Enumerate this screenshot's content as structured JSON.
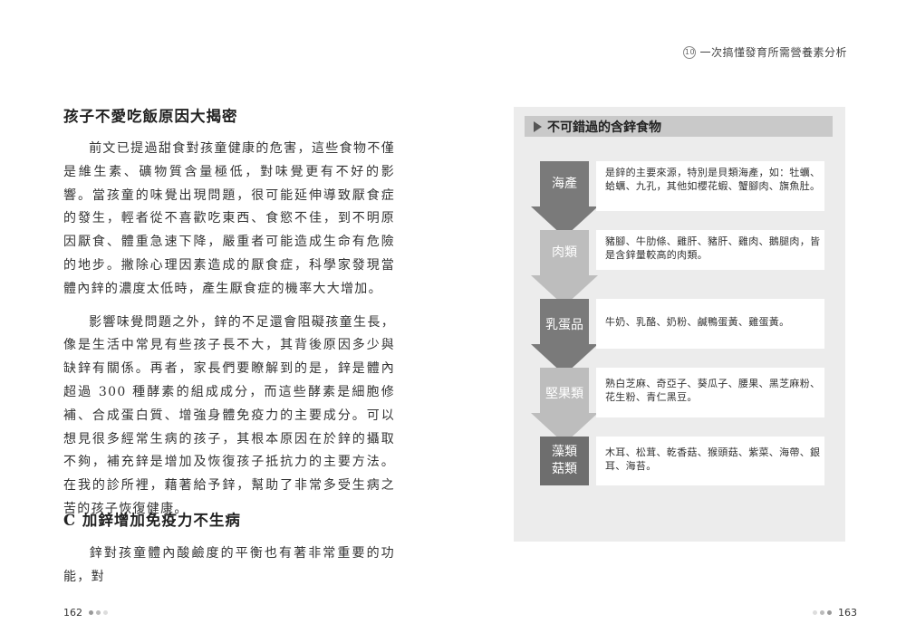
{
  "header": {
    "badge": "10",
    "title": "一次搞懂發育所需營養素分析"
  },
  "left": {
    "heading1": "孩子不愛吃飯原因大揭密",
    "para1": "前文已提過甜食對孩童健康的危害，這些食物不僅是維生素、礦物質含量極低，對味覺更有不好的影響。當孩童的味覺出現問題，很可能延伸導致厭食症的發生，輕者從不喜歡吃東西、食慾不佳，到不明原因厭食、體重急速下降，嚴重者可能造成生命有危險的地步。撇除心理因素造成的厭食症，科學家發現當體內鋅的濃度太低時，產生厭食症的機率大大增加。",
    "para2": "影響味覺問題之外，鋅的不足還會阻礙孩童生長，像是生活中常見有些孩子長不大，其背後原因多少與缺鋅有關係。再者，家長們要瞭解到的是，鋅是體內超過 300 種酵素的組成成分，而這些酵素是細胞修補、合成蛋白質、增強身體免疫力的主要成分。可以想見很多經常生病的孩子，其根本原因在於鋅的攝取不夠，補充鋅是增加及恢復孩子抵抗力的主要方法。在我的診所裡，藉著給予鋅，幫助了非常多受生病之苦的孩子恢復健康。",
    "heading2": "C 加鋅增加免疫力不生病",
    "para3": "鋅對孩童體內酸鹼度的平衡也有著非常重要的功能，對"
  },
  "page_left": "162",
  "page_right": "163",
  "panel": {
    "title": "不可錯過的含鋅食物",
    "items": [
      {
        "label": "海產",
        "desc": "是鋅的主要來源，特別是貝類海產，如：牡蠣、蛤蠣、九孔，其他如櫻花蝦、蟹腳肉、旗魚肚。",
        "color": "#7a7a7a"
      },
      {
        "label": "肉類",
        "desc": "豬腳、牛肋條、雞肝、豬肝、雞肉、鵝腿肉，皆是含鋅量較高的肉類。",
        "color": "#bdbdbd"
      },
      {
        "label": "乳蛋品",
        "desc": "牛奶、乳酪、奶粉、鹹鴨蛋黃、雞蛋黃。",
        "color": "#7a7a7a"
      },
      {
        "label": "堅果類",
        "desc": "熟白芝麻、奇亞子、葵瓜子、腰果、黑芝麻粉、花生粉、青仁黑豆。",
        "color": "#bdbdbd"
      },
      {
        "label": "藻類菇類",
        "desc": "木耳、松茸、乾香菇、猴頭菇、紫菜、海帶、銀耳、海苔。",
        "color": "#6e6e6e"
      }
    ]
  }
}
